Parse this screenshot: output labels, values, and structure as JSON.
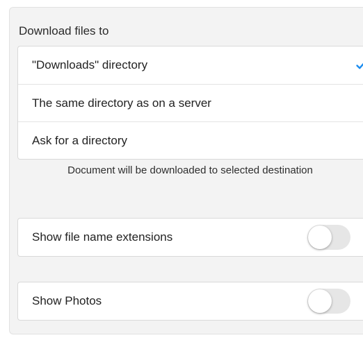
{
  "download_section": {
    "header": "Download files to",
    "options": [
      {
        "label": "\"Downloads\" directory",
        "selected": true
      },
      {
        "label": "The same directory as on a server",
        "selected": false
      },
      {
        "label": "Ask for a directory",
        "selected": false
      }
    ],
    "footer": "Document will be downloaded to selected destination"
  },
  "toggles": [
    {
      "label": "Show file name extensions",
      "on": false
    },
    {
      "label": "Show Photos",
      "on": false
    }
  ],
  "colors": {
    "accent": "#1a8cf0",
    "panel_background": "#f3f3f3",
    "switch_off": "#e6e6e6"
  },
  "icons": {
    "selected": "checkmark-icon"
  }
}
